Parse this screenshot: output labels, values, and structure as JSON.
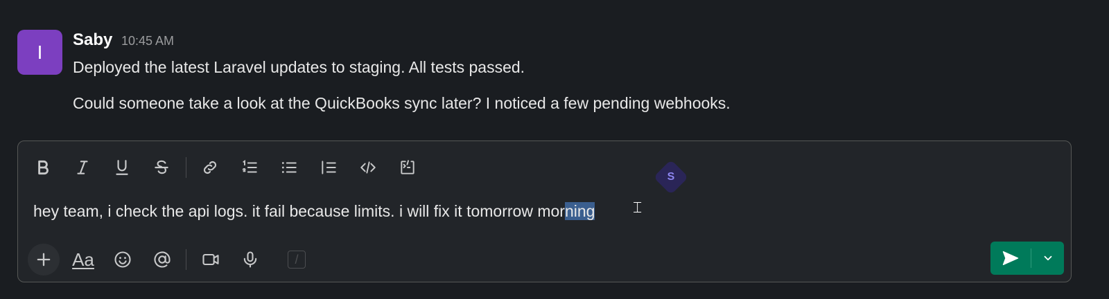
{
  "message": {
    "avatar_initial": "I",
    "author": "Saby",
    "time": "10:45 AM",
    "lines": [
      "Deployed the latest Laravel updates to staging. All tests passed.",
      "Could someone take a look at the QuickBooks sync later? I noticed a few pending webhooks."
    ]
  },
  "composer": {
    "toolbar": [
      "bold-icon",
      "italic-icon",
      "underline-icon",
      "strikethrough-icon",
      "link-icon",
      "ordered-list-icon",
      "bulleted-list-icon",
      "blockquote-icon",
      "code-icon",
      "code-block-icon"
    ],
    "presence_initial": "S",
    "text_before_selection": "hey team, i check the api logs. it fail because limits. i will fix it tomorrow mor",
    "text_selected": "ning",
    "format_label": "Aa",
    "shortcut_label": "/"
  },
  "colors": {
    "background": "#1a1d21",
    "avatar": "#7c3fc0",
    "send_button": "#007a5a",
    "selection": "#3b5f8f"
  }
}
